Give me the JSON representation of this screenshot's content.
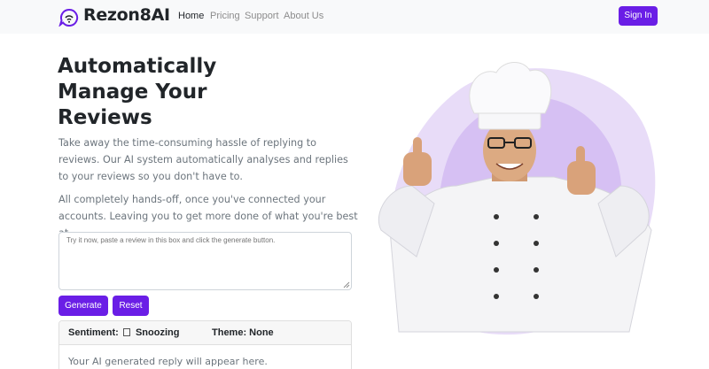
{
  "navbar": {
    "brand": "Rezon8AI",
    "links": [
      {
        "label": "Home",
        "active": true
      },
      {
        "label": "Pricing",
        "active": false
      },
      {
        "label": "Support",
        "active": false
      },
      {
        "label": "About Us",
        "active": false
      }
    ],
    "signin_label": "Sign In",
    "logo_icon": "chat-bubble-wifi-icon"
  },
  "hero": {
    "headline_lines": [
      "Automatically",
      "Manage Your",
      "Reviews"
    ],
    "paragraph1": "Take away the time-consuming hassle of replying to reviews. Our AI system automatically analyses and replies to your reviews so you don't have to.",
    "paragraph2": "All completely hands-off, once you've connected your accounts. Leaving you to get more done of what you're best at.",
    "review_input": {
      "value": "",
      "placeholder": "Try it now, paste a review in this box and click the generate button."
    },
    "generate_label": "Generate",
    "reset_label": "Reset",
    "result": {
      "sentiment_text": "Sentiment: ☐ Snoozing",
      "sentiment_label": "Sentiment:",
      "sentiment_value": "Snoozing",
      "theme_text": "Theme: None",
      "reply_placeholder": "Your AI generated reply will appear here."
    },
    "image_subject": "chef-thumbs-up-photo"
  },
  "colors": {
    "accent": "#6a1ee6",
    "navbar_bg": "#f8f9fa",
    "blob_light": "#e8dcf8",
    "blob_mid": "#c9aef0"
  }
}
